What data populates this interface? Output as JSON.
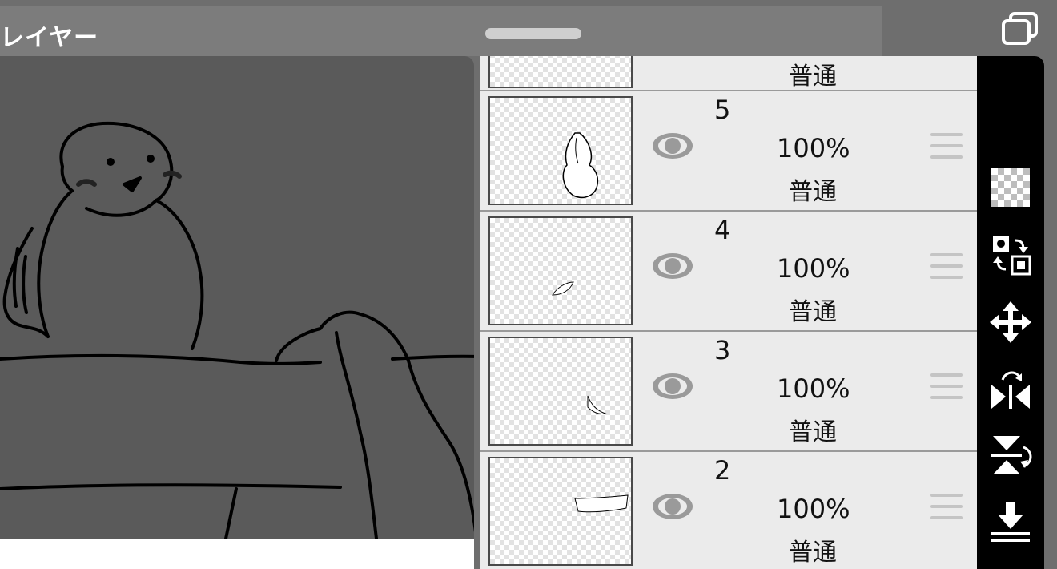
{
  "header": {
    "title": "レイヤー"
  },
  "layers": [
    {
      "name": "5",
      "opacity": "100%",
      "blend": "普通"
    },
    {
      "name": "4",
      "opacity": "100%",
      "blend": "普通"
    },
    {
      "name": "3",
      "opacity": "100%",
      "blend": "普通"
    },
    {
      "name": "2",
      "opacity": "100%",
      "blend": "普通"
    }
  ],
  "partial_layer": {
    "blend": "普通"
  },
  "toolbar": {
    "icons": [
      "transparency-icon",
      "swap-layers-icon",
      "move-icon",
      "flip-horizontal-icon",
      "flip-vertical-icon",
      "merge-down-icon"
    ]
  },
  "colors": {
    "background": "#6e6e6e",
    "header": "#7c7c7c",
    "list": "#ebebeb",
    "toolbar": "#000000"
  }
}
